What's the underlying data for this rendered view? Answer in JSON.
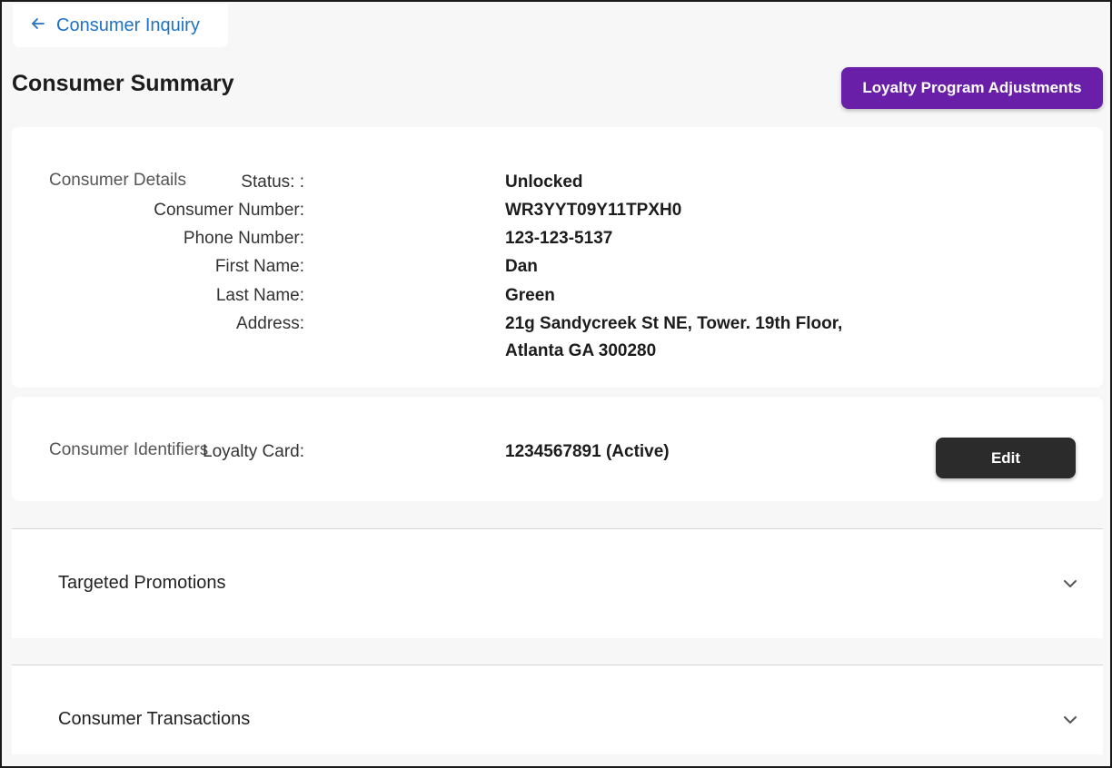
{
  "nav": {
    "back_label": "Consumer Inquiry",
    "back_icon": "arrow-left-icon"
  },
  "header": {
    "title": "Consumer Summary",
    "loyalty_button_label": "Loyalty Program Adjustments"
  },
  "consumer_details": {
    "section_label": "Consumer Details",
    "fields": [
      {
        "label": "Status: :",
        "value": "Unlocked"
      },
      {
        "label": "Consumer Number:",
        "value": "WR3YYT09Y11TPXH0"
      },
      {
        "label": "Phone Number:",
        "value": "123-123-5137"
      },
      {
        "label": "First Name:",
        "value": "Dan"
      },
      {
        "label": "Last Name:",
        "value": "Green"
      },
      {
        "label": "Address:",
        "value": "21g Sandycreek St NE, Tower. 19th Floor,",
        "value_line2": "Atlanta GA 300280"
      }
    ]
  },
  "consumer_identifiers": {
    "section_label": "Consumer Identifiers",
    "loyalty_card_label": "Loyalty Card:",
    "loyalty_card_value": "1234567891 (Active)",
    "edit_button_label": "Edit"
  },
  "accordions": [
    {
      "title": "Targeted Promotions",
      "icon": "chevron-down-icon",
      "expanded": false
    },
    {
      "title": "Consumer Transactions",
      "icon": "chevron-down-icon",
      "expanded": false
    }
  ],
  "colors": {
    "accent_link": "#1f72c4",
    "primary_button": "#6a1fa8",
    "dark_button": "#2b2b2b",
    "page_background": "#f7f7f7"
  }
}
